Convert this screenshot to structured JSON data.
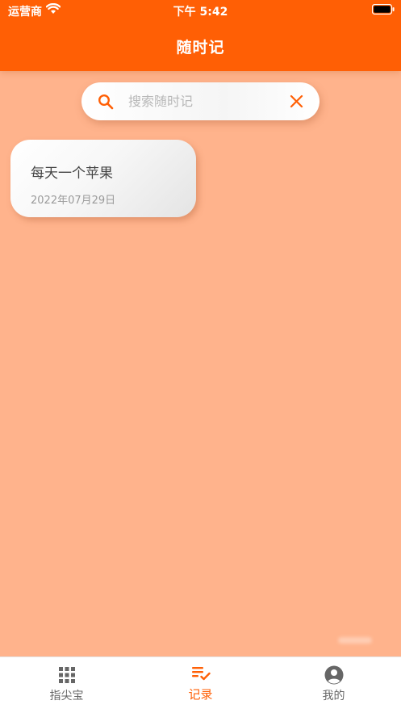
{
  "status_bar": {
    "carrier": "运营商",
    "time": "下午 5:42"
  },
  "header": {
    "title": "随时记"
  },
  "search": {
    "placeholder": "搜索随时记",
    "value": ""
  },
  "notes": [
    {
      "title": "每天一个苹果",
      "date": "2022年07月29日"
    }
  ],
  "tabs": [
    {
      "label": "指尖宝",
      "icon": "grid-icon",
      "active": false
    },
    {
      "label": "记录",
      "icon": "checklist-icon",
      "active": true
    },
    {
      "label": "我的",
      "icon": "account-icon",
      "active": false
    }
  ],
  "colors": {
    "accent": "#FF5F05",
    "background": "#FFB38C",
    "tab_inactive": "#666666"
  }
}
